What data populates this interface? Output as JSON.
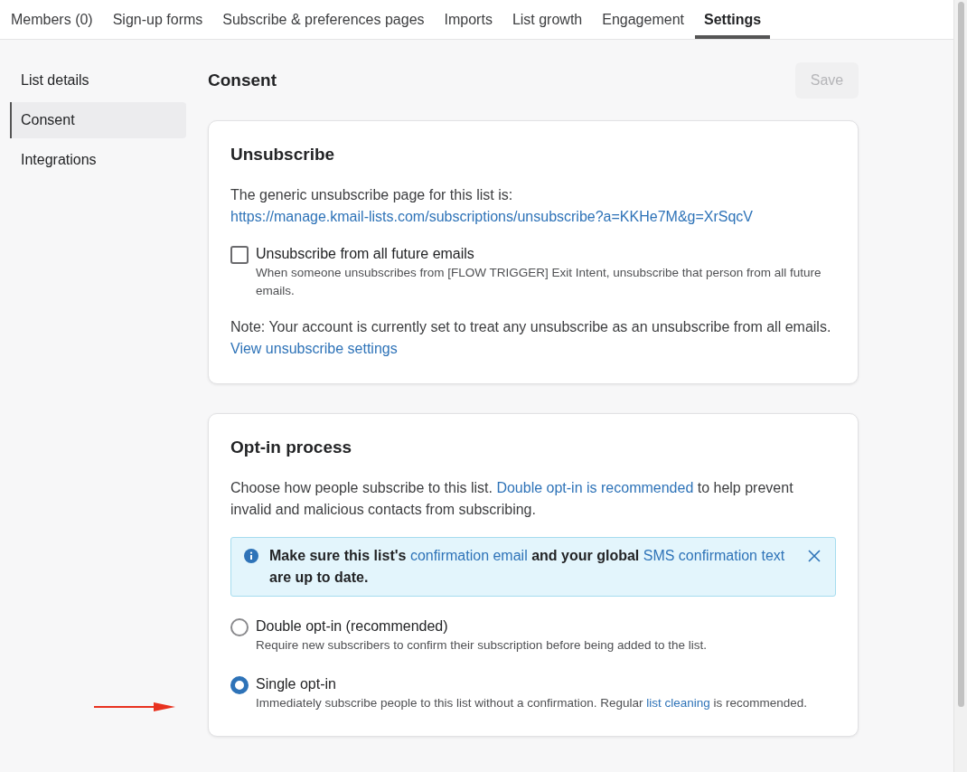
{
  "tabs": [
    {
      "label": "Members (0)",
      "selected": false
    },
    {
      "label": "Sign-up forms",
      "selected": false
    },
    {
      "label": "Subscribe & preferences pages",
      "selected": false
    },
    {
      "label": "Imports",
      "selected": false
    },
    {
      "label": "List growth",
      "selected": false
    },
    {
      "label": "Engagement",
      "selected": false
    },
    {
      "label": "Settings",
      "selected": true
    }
  ],
  "sidebar": {
    "items": [
      {
        "label": "List details",
        "selected": false
      },
      {
        "label": "Consent",
        "selected": true
      },
      {
        "label": "Integrations",
        "selected": false
      }
    ]
  },
  "page_title": "Consent",
  "save_button": {
    "label": "Save",
    "disabled": true
  },
  "unsubscribe": {
    "title": "Unsubscribe",
    "intro": [
      {
        "kind": "text",
        "text": "The generic unsubscribe page for this list is: "
      },
      {
        "kind": "link",
        "text": "https://manage.kmail-lists.com/subscriptions/unsubscribe?a=KKHe7M&g=XrSqcV"
      }
    ],
    "checkbox": {
      "label": "Unsubscribe from all future emails",
      "description": "When someone unsubscribes from [FLOW TRIGGER] Exit Intent, unsubscribe that person from all future emails.",
      "checked": false
    },
    "note": [
      {
        "kind": "text",
        "text": "Note: Your account is currently set to treat any unsubscribe as an unsubscribe from all emails. "
      },
      {
        "kind": "link",
        "text": "View unsubscribe settings"
      }
    ]
  },
  "opt_in": {
    "title": "Opt-in process",
    "intro": [
      {
        "kind": "text",
        "text": "Choose how people subscribe to this list. "
      },
      {
        "kind": "link",
        "text": "Double opt-in is recommended"
      },
      {
        "kind": "text",
        "text": " to help prevent invalid and malicious contacts from subscribing."
      }
    ],
    "alert": [
      {
        "kind": "text",
        "text": "Make sure this list's "
      },
      {
        "kind": "link",
        "text": "confirmation email"
      },
      {
        "kind": "text",
        "text": " and your global "
      },
      {
        "kind": "link",
        "text": "SMS confirmation text"
      },
      {
        "kind": "text",
        "text": " are up to date."
      }
    ],
    "options": [
      {
        "label": "Double opt-in (recommended)",
        "description": [
          {
            "kind": "text",
            "text": "Require new subscribers to confirm their subscription before being added to the list."
          }
        ],
        "selected": false
      },
      {
        "label": "Single opt-in",
        "description": [
          {
            "kind": "text",
            "text": "Immediately subscribe people to this list without a confirmation. Regular "
          },
          {
            "kind": "link",
            "text": "list cleaning"
          },
          {
            "kind": "text",
            "text": " is recommended."
          }
        ],
        "selected": true
      }
    ]
  }
}
